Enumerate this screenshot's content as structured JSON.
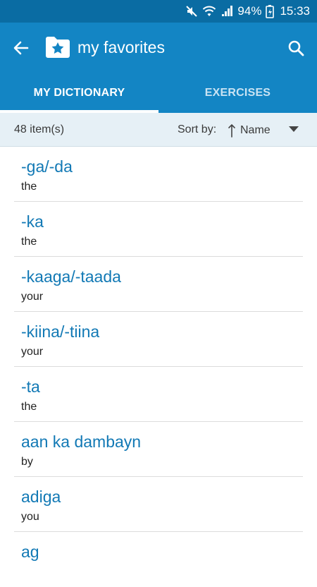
{
  "status": {
    "battery": "94%",
    "time": "15:33",
    "icons": [
      "mute-icon",
      "wifi-icon",
      "signal-icon",
      "battery-charging-icon"
    ]
  },
  "header": {
    "title": "my favorites",
    "back_icon": "arrow-left-icon",
    "folder_icon": "star-folder-icon",
    "search_icon": "search-icon"
  },
  "tabs": [
    {
      "label": "MY DICTIONARY",
      "active": true
    },
    {
      "label": "EXERCISES",
      "active": false
    }
  ],
  "subbar": {
    "count": "48 item(s)",
    "sort_label": "Sort by:",
    "sort_value": "Name"
  },
  "items": [
    {
      "term": "-ga/-da",
      "translation": "the"
    },
    {
      "term": "-ka",
      "translation": "the"
    },
    {
      "term": "-kaaga/-taada",
      "translation": "your"
    },
    {
      "term": "-kiina/-tiina",
      "translation": "your"
    },
    {
      "term": "-ta",
      "translation": "the"
    },
    {
      "term": "aan ka dambayn",
      "translation": "by"
    },
    {
      "term": "adiga",
      "translation": "you"
    },
    {
      "term": "ag",
      "translation": ""
    }
  ],
  "colors": {
    "status_bar": "#0a6ca3",
    "app_bar": "#1385c4",
    "term_text": "#1279b5",
    "subbar_bg": "#e6f0f6"
  }
}
